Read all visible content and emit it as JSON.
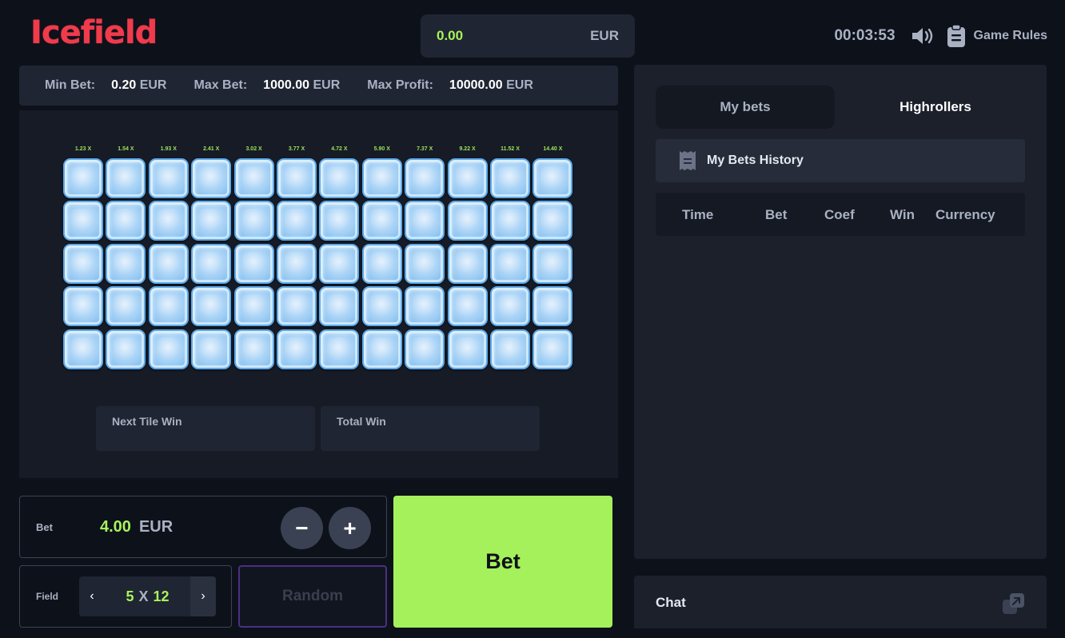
{
  "header": {
    "logo": "Icefield",
    "balance_amount": "0.00",
    "balance_currency": "EUR",
    "timer": "00:03:53",
    "rules_label": "Game Rules",
    "sound_icon": "speaker-icon",
    "rules_icon": "clipboard-icon"
  },
  "limits": {
    "min_label": "Min Bet:",
    "min_value": "0.20",
    "min_currency": "EUR",
    "max_label": "Max Bet:",
    "max_value": "1000.00",
    "max_currency": "EUR",
    "profit_label": "Max Profit:",
    "profit_value": "10000.00",
    "profit_currency": "EUR"
  },
  "game": {
    "multipliers": [
      "1.23 X",
      "1.54 X",
      "1.93 X",
      "2.41 X",
      "3.02 X",
      "3.77 X",
      "4.72 X",
      "5.90 X",
      "7.37 X",
      "9.22 X",
      "11.52 X",
      "14.40 X"
    ],
    "rows": 5,
    "cols": 12,
    "next_tile_win_label": "Next Tile Win",
    "total_win_label": "Total Win"
  },
  "controls": {
    "bet_label": "Bet",
    "bet_amount": "4.00",
    "bet_currency": "EUR",
    "minus": "−",
    "plus": "+",
    "field_label": "Field",
    "field_rows": "5",
    "field_x": "X",
    "field_cols": "12",
    "prev_arrow": "‹",
    "next_arrow": "›",
    "random_label": "Random",
    "bet_button": "Bet"
  },
  "panel": {
    "tab_my_bets": "My bets",
    "tab_highrollers": "Highrollers",
    "history_label": "My Bets History",
    "columns": [
      "Time",
      "Bet",
      "Coef",
      "Win",
      "Currency"
    ]
  },
  "chat": {
    "title": "Chat"
  },
  "colors": {
    "accent_green": "#a8f25c",
    "logo_red": "#ef3b4c",
    "bg": "#0d111a",
    "panel": "#1b202b"
  }
}
